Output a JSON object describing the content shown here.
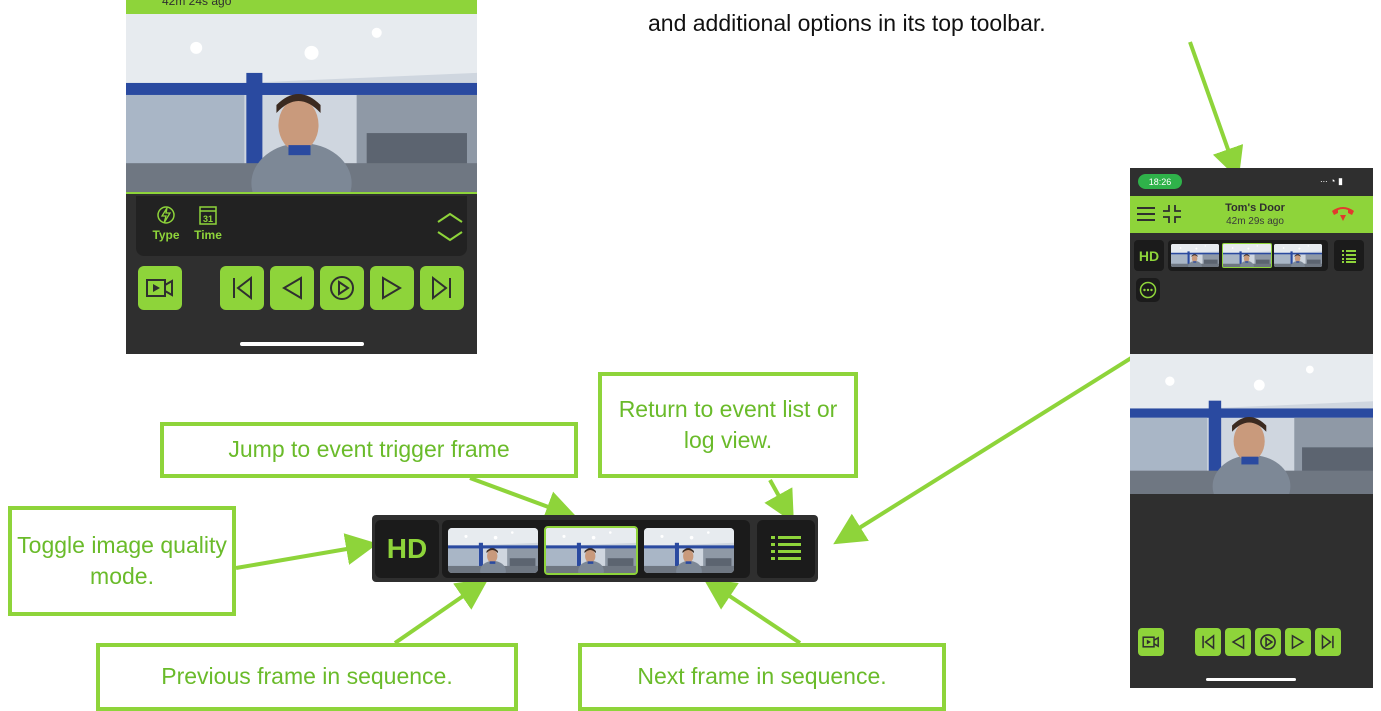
{
  "caption": "and additional options in its top toolbar.",
  "phone1": {
    "top_subtitle": "42m 24s ago",
    "filters": [
      {
        "label": "Type",
        "icon": "lightning-icon"
      },
      {
        "label": "Time",
        "icon": "calendar-icon",
        "badge": "31"
      }
    ],
    "controls": [
      "video-camera-icon",
      "skip-first-icon",
      "step-back-icon",
      "play-icon",
      "step-forward-icon",
      "skip-last-icon"
    ]
  },
  "callouts": {
    "toggle_quality": "Toggle image quality mode.",
    "jump_trigger": "Jump to event trigger frame",
    "return_list": "Return to event list or log view.",
    "previous_frame": "Previous frame in sequence.",
    "next_frame": "Next frame in sequence."
  },
  "toolbar": {
    "hd_label": "HD",
    "thumbnails": [
      "previous-frame",
      "trigger-frame",
      "next-frame"
    ],
    "list_icon": "list-icon"
  },
  "phone2": {
    "time": "18:26",
    "status_icons": "∙∙∙ ◔ ▮",
    "title": "Tom's Door",
    "subtitle": "42m 29s ago",
    "hd_label": "HD"
  },
  "colors": {
    "accent": "#8ed43a",
    "accent_text": "#6abb2a",
    "dark_panel": "#2f2f2f",
    "darker_panel": "#1b1b1b",
    "end_call": "#e23a2e"
  }
}
